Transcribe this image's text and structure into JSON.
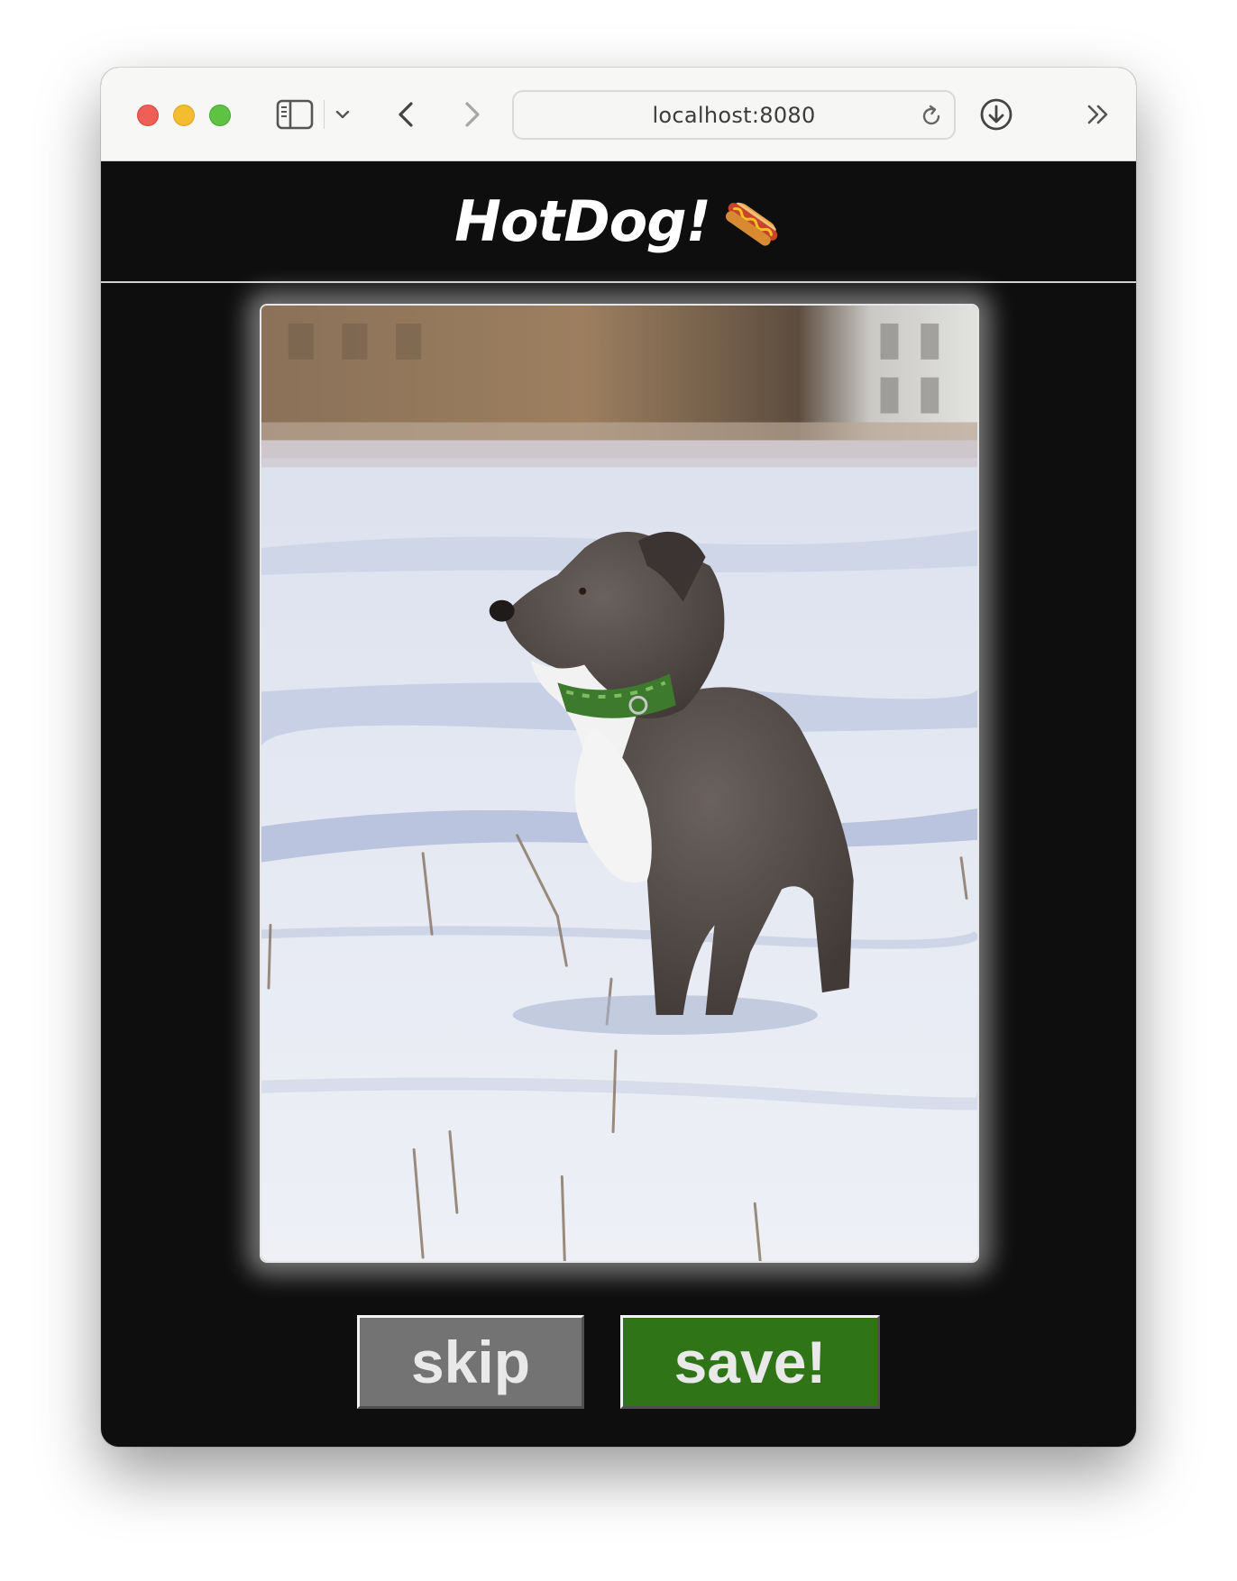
{
  "browser": {
    "address": "localhost:8080",
    "icons": [
      "sidebar-icon",
      "chevron-down-icon",
      "back-icon",
      "forward-icon",
      "reload-icon",
      "download-icon",
      "more-icon"
    ]
  },
  "app": {
    "title": "HotDog!",
    "title_emoji": "hot-dog-emoji"
  },
  "photo": {
    "subject": "dog-photo"
  },
  "actions": {
    "skip_label": "skip",
    "save_label": "save!",
    "skip_color": "#737373",
    "save_color": "#2f7518"
  }
}
